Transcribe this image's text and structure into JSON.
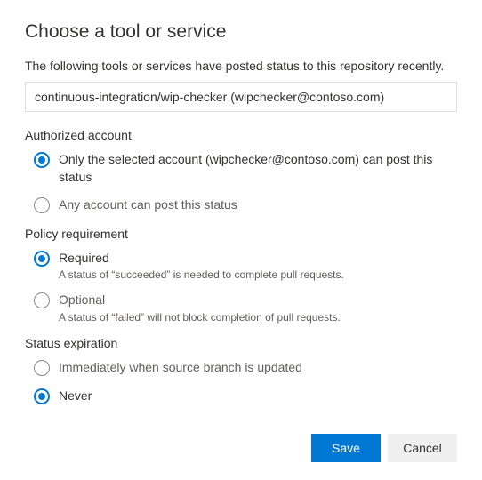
{
  "title": "Choose a tool or service",
  "subtitle": "The following tools or services have posted status to this repository recently.",
  "dropdown_value": "continuous-integration/wip-checker (wipchecker@contoso.com)",
  "sections": {
    "authorized": {
      "label": "Authorized account",
      "opt_selected": "Only the selected account (wipchecker@contoso.com) can post this status",
      "opt_any": "Any account can post this status"
    },
    "policy": {
      "label": "Policy requirement",
      "opt_required": "Required",
      "opt_required_desc": "A status of “succeeded” is needed to complete pull requests.",
      "opt_optional": "Optional",
      "opt_optional_desc": "A status of “failed” will not block completion of pull requests."
    },
    "expiration": {
      "label": "Status expiration",
      "opt_immediate": "Immediately when source branch is updated",
      "opt_never": "Never"
    }
  },
  "buttons": {
    "save": "Save",
    "cancel": "Cancel"
  }
}
